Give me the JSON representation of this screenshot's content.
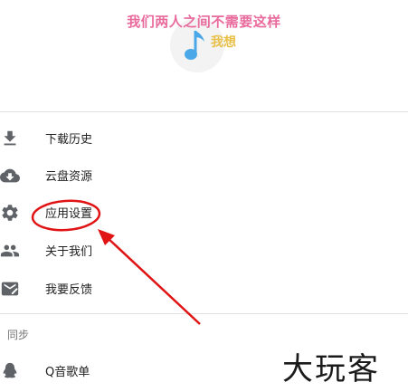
{
  "header": {
    "title": "我们两人之间不需要这样",
    "subtitle": "我想"
  },
  "menu": [
    {
      "label": "下载历史",
      "icon": "download-icon"
    },
    {
      "label": "云盘资源",
      "icon": "cloud-icon"
    },
    {
      "label": "应用设置",
      "icon": "gear-icon"
    },
    {
      "label": "关于我们",
      "icon": "people-icon"
    },
    {
      "label": "我要反馈",
      "icon": "feedback-icon"
    }
  ],
  "section": {
    "label": "同步",
    "items": [
      {
        "label": "Q音歌单",
        "icon": "qq-icon"
      }
    ]
  },
  "watermark": "大玩客",
  "colors": {
    "title": "#e96a9c",
    "subtitle": "#e8c04a",
    "note": "#4aa8e8",
    "icon": "#5f6368",
    "annotation": "#e01414"
  }
}
